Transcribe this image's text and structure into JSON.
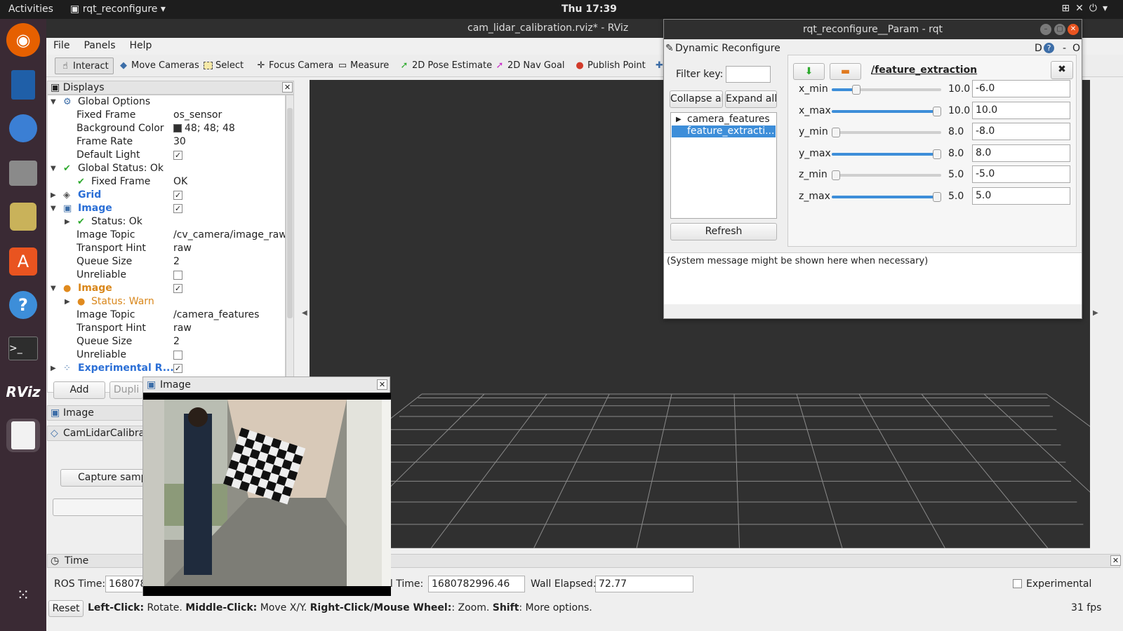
{
  "topbar": {
    "activities": "Activities",
    "app_name": "rqt_reconfigure",
    "clock": "Thu 17:39"
  },
  "dock": {
    "items": [
      "firefox-icon",
      "writer-icon",
      "thunderbird-icon",
      "files-icon",
      "rhythmbox-icon",
      "software-icon",
      "help-icon",
      "terminal-icon",
      "rviz-icon",
      "text-editor-icon"
    ]
  },
  "rviz": {
    "title": "cam_lidar_calibration.rviz* - RViz",
    "menu": [
      "File",
      "Panels",
      "Help"
    ],
    "tools": [
      "Interact",
      "Move Cameras",
      "Select",
      "Focus Camera",
      "Measure",
      "2D Pose Estimate",
      "2D Nav Goal",
      "Publish Point"
    ],
    "displays": {
      "title": "Displays",
      "rows": [
        {
          "label": "Global Options",
          "value": ""
        },
        {
          "label": "Fixed Frame",
          "value": "os_sensor"
        },
        {
          "label": "Background Color",
          "value": "48; 48; 48"
        },
        {
          "label": "Frame Rate",
          "value": "30"
        },
        {
          "label": "Default Light",
          "value": ""
        },
        {
          "label": "Global Status: Ok",
          "value": ""
        },
        {
          "label": "Fixed Frame",
          "value": "OK"
        },
        {
          "label": "Grid",
          "value": ""
        },
        {
          "label": "Image",
          "value": ""
        },
        {
          "label": "Status: Ok",
          "value": ""
        },
        {
          "label": "Image Topic",
          "value": "/cv_camera/image_raw"
        },
        {
          "label": "Transport Hint",
          "value": "raw"
        },
        {
          "label": "Queue Size",
          "value": "2"
        },
        {
          "label": "Unreliable",
          "value": ""
        },
        {
          "label": "Image",
          "value": ""
        },
        {
          "label": "Status: Warn",
          "value": ""
        },
        {
          "label": "Image Topic",
          "value": "/camera_features"
        },
        {
          "label": "Transport Hint",
          "value": "raw"
        },
        {
          "label": "Queue Size",
          "value": "2"
        },
        {
          "label": "Unreliable",
          "value": ""
        },
        {
          "label": "Experimental R...",
          "value": ""
        }
      ]
    },
    "buttons": {
      "add": "Add",
      "duplicate": "Dupli"
    },
    "panels": {
      "image": "Image",
      "camlidar": "CamLidarCalibra",
      "capture": "Capture samp"
    },
    "image_window": {
      "title": "Image"
    },
    "time": {
      "title": "Time",
      "ros_time_label": "ROS Time:",
      "ros_time": "168078",
      "wall_time_label": "ll Time:",
      "wall_time": "1680782996.46",
      "wall_elapsed_label": "Wall Elapsed:",
      "wall_elapsed": "72.77",
      "experimental": "Experimental"
    },
    "status": {
      "reset": "Reset",
      "b1": "Left-Click:",
      "t1": " Rotate. ",
      "b2": "Middle-Click:",
      "t2": " Move X/Y. ",
      "b3": "Right-Click/Mouse Wheel:",
      "t3": ": Zoom. ",
      "b4": "Shift",
      "t4": ": More options.",
      "fps": "31 fps"
    }
  },
  "rqt": {
    "title": "rqt_reconfigure__Param - rqt",
    "plugin": "Dynamic Reconfigure",
    "plugin_right": "D",
    "filter_label": "Filter key:",
    "filter_value": "",
    "collapse": "Collapse all",
    "expand": "Expand all",
    "nodes": [
      "camera_features",
      "feature_extracti..."
    ],
    "refresh": "Refresh",
    "group": "/feature_extraction",
    "params": [
      {
        "name": "x_min",
        "max": "10.0",
        "value": "-6.0",
        "fraction": 0.2
      },
      {
        "name": "x_max",
        "max": "10.0",
        "value": "10.0",
        "fraction": 1.0
      },
      {
        "name": "y_min",
        "max": "8.0",
        "value": "-8.0",
        "fraction": 0.0
      },
      {
        "name": "y_max",
        "max": "8.0",
        "value": "8.0",
        "fraction": 1.0
      },
      {
        "name": "z_min",
        "max": "5.0",
        "value": "-5.0",
        "fraction": 0.0
      },
      {
        "name": "z_max",
        "max": "5.0",
        "value": "5.0",
        "fraction": 1.0
      }
    ],
    "message": "(System message might be shown here when necessary)"
  }
}
